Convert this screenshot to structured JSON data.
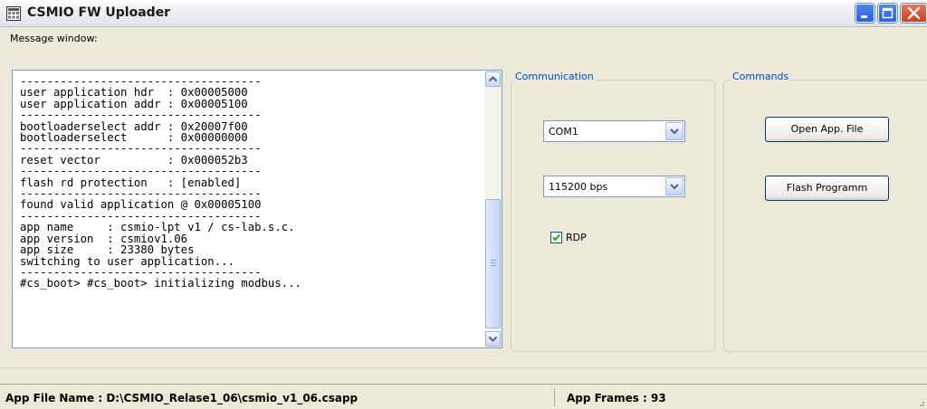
{
  "window": {
    "title": "CSMIO FW Uploader"
  },
  "message_window": {
    "label": "Message window:",
    "lines": [
      "------------------------------------",
      "user application hdr  : 0x00005000",
      "user application addr : 0x00005100",
      "------------------------------------",
      "bootloaderselect addr : 0x20007f00",
      "bootloaderselect      : 0x00000000",
      "------------------------------------",
      "reset vector          : 0x000052b3",
      "------------------------------------",
      "flash rd protection   : [enabled]",
      "------------------------------------",
      "found valid application @ 0x00005100",
      "------------------------------------",
      "app name     : csmio-lpt v1 / cs-lab.s.c.",
      "app version  : csmiov1.06",
      "app size     : 23380 bytes",
      "switching to user application...",
      "------------------------------------",
      "#cs_boot> #cs_boot> initializing modbus..."
    ]
  },
  "communication": {
    "legend": "Communication",
    "port": "COM1",
    "baud": "115200 bps",
    "rdp_label": "RDP",
    "rdp_checked": true
  },
  "commands": {
    "legend": "Commands",
    "open_label": "Open App. File",
    "flash_label": "Flash Programm"
  },
  "status": {
    "file_name": "App File Name : D:\\CSMIO_Relase1_06\\csmio_v1_06.csapp",
    "frames": "App Frames : 93"
  }
}
